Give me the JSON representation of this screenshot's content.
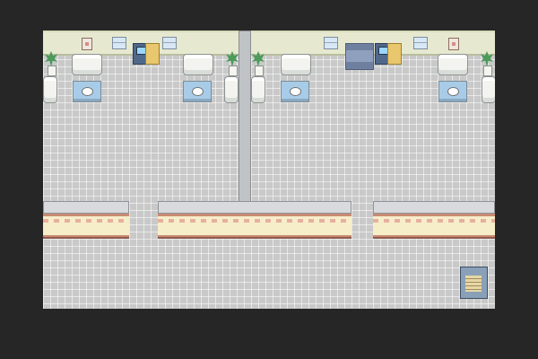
{
  "palette": {
    "letterbox": "#262626",
    "floor": "#c9c9c9",
    "wall": "#e6e9cf",
    "partition": "#bfc3c6",
    "counter_front": "#f6edc9",
    "counter_trim": "#c98b72",
    "sofa": "#f3f3ef",
    "table": "#a8cbe8",
    "plant": "#4d9a5a",
    "computer": "#50688a",
    "desk": "#e8c76e",
    "stairs": "#8aa0b8"
  },
  "objects": {
    "left_room": {
      "back_wall_items": [
        "picture-frame-icon",
        "window-icon",
        "window-icon",
        "computer-terminal-icon",
        "potted-plant-icon",
        "potted-plant-icon"
      ],
      "furniture": [
        "sofa-icon",
        "sofa-icon",
        "sofa-icon",
        "glass-table-icon",
        "glass-table-icon"
      ]
    },
    "right_room": {
      "back_wall_items": [
        "window-icon",
        "bookshelf-icon",
        "computer-terminal-icon",
        "window-icon",
        "picture-frame-icon",
        "potted-plant-icon",
        "potted-plant-icon"
      ],
      "furniture": [
        "sofa-icon",
        "sofa-icon",
        "sofa-icon",
        "glass-table-icon",
        "glass-table-icon"
      ]
    },
    "corridor": {
      "items": [
        "counter-icon",
        "counter-icon",
        "counter-icon",
        "staircase-icon"
      ]
    }
  }
}
